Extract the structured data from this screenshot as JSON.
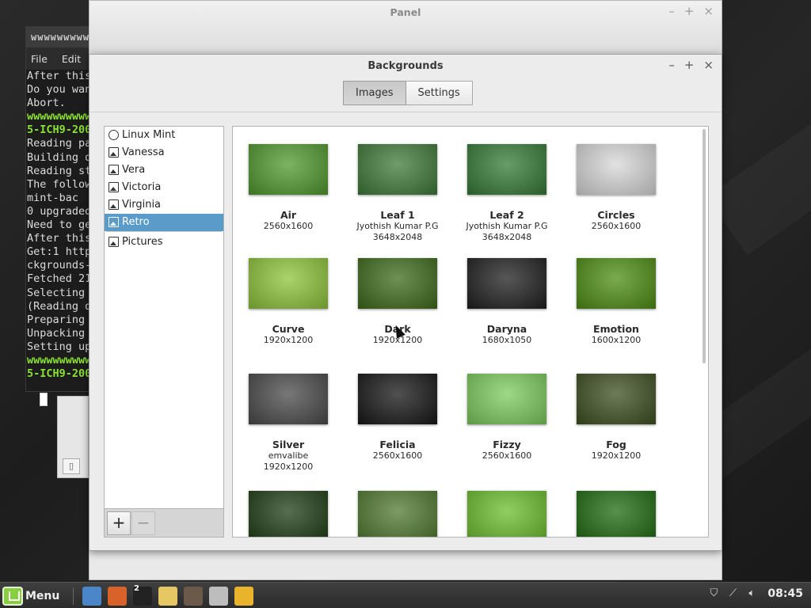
{
  "terminal": {
    "title": "wwwwwwwwwwww",
    "menu": [
      "File",
      "Edit"
    ],
    "lines": [
      {
        "t": "After this",
        "green": false
      },
      {
        "t": "Do you wan",
        "green": false
      },
      {
        "t": "Abort.",
        "green": false
      },
      {
        "t": "wwwwwwwwwwww",
        "green": true
      },
      {
        "t": "5-ICH9-200",
        "green": true
      },
      {
        "t": "Reading pa",
        "green": false
      },
      {
        "t": "Building d",
        "green": false
      },
      {
        "t": "Reading st",
        "green": false
      },
      {
        "t": "The follow",
        "green": false
      },
      {
        "t": "  mint-bac",
        "green": false
      },
      {
        "t": "0 upgraded",
        "green": false
      },
      {
        "t": "Need to ge",
        "green": false
      },
      {
        "t": "After this",
        "green": false
      },
      {
        "t": "Get:1 http",
        "green": false
      },
      {
        "t": "ckgrounds-",
        "green": false
      },
      {
        "t": "Fetched 21",
        "green": false
      },
      {
        "t": "Selecting",
        "green": false
      },
      {
        "t": "(Reading d",
        "green": false
      },
      {
        "t": "Preparing",
        "green": false
      },
      {
        "t": "Unpacking",
        "green": false
      },
      {
        "t": "Setting up",
        "green": false
      },
      {
        "t": "wwwwwwwwwwww",
        "green": true
      },
      {
        "t": "5-ICH9-200",
        "green": true
      }
    ]
  },
  "panel_window": {
    "title": "Panel",
    "controls": [
      "–",
      "+",
      "×"
    ]
  },
  "backgrounds_window": {
    "title": "Backgrounds",
    "controls": [
      "–",
      "+",
      "×"
    ],
    "tabs": [
      {
        "label": "Images",
        "active": true
      },
      {
        "label": "Settings",
        "active": false
      }
    ]
  },
  "sidebar": {
    "items": [
      {
        "label": "Linux Mint",
        "icon": "mint-icon",
        "selected": false
      },
      {
        "label": "Vanessa",
        "icon": "image-icon",
        "selected": false
      },
      {
        "label": "Vera",
        "icon": "image-icon",
        "selected": false
      },
      {
        "label": "Victoria",
        "icon": "image-icon",
        "selected": false
      },
      {
        "label": "Virginia",
        "icon": "image-icon",
        "selected": false
      },
      {
        "label": "Retro",
        "icon": "image-icon",
        "selected": true
      }
    ],
    "extra_items": [
      {
        "label": "Pictures",
        "icon": "folder-icon"
      }
    ],
    "add_label": "+",
    "remove_label": "−"
  },
  "wallpapers": [
    {
      "name": "Air",
      "author": "",
      "res": "2560x1600",
      "bg": "#4f9a2f"
    },
    {
      "name": "Leaf 1",
      "author": "Jyothish Kumar P.G",
      "res": "3648x2048",
      "bg": "#3f7a3a"
    },
    {
      "name": "Leaf 2",
      "author": "Jyothish Kumar P.G",
      "res": "3648x2048",
      "bg": "#357a36"
    },
    {
      "name": "Circles",
      "author": "",
      "res": "2560x1600",
      "bg": "#d8d8d8"
    },
    {
      "name": "Curve",
      "author": "",
      "res": "1920x1200",
      "bg": "#8ec63a"
    },
    {
      "name": "Dark",
      "author": "",
      "res": "1920x1200",
      "bg": "#3e6b1a"
    },
    {
      "name": "Daryna",
      "author": "",
      "res": "1680x1050",
      "bg": "#1f1f1f"
    },
    {
      "name": "Emotion",
      "author": "",
      "res": "1600x1200",
      "bg": "#4e8d14"
    },
    {
      "name": "Silver",
      "author": "emvalibe",
      "res": "1920x1200",
      "bg": "#4a4a4a"
    },
    {
      "name": "Felicia",
      "author": "",
      "res": "2560x1600",
      "bg": "#161616"
    },
    {
      "name": "Fizzy",
      "author": "",
      "res": "2560x1600",
      "bg": "#7ccc5e"
    },
    {
      "name": "Fog",
      "author": "",
      "res": "1920x1200",
      "bg": "#3d4f20"
    },
    {
      "name": "",
      "author": "",
      "res": "",
      "bg": "#1f3d14"
    },
    {
      "name": "",
      "author": "",
      "res": "",
      "bg": "#4f7a30"
    },
    {
      "name": "",
      "author": "",
      "res": "",
      "bg": "#6cbf2f"
    },
    {
      "name": "",
      "author": "",
      "res": "",
      "bg": "#1f6a10"
    }
  ],
  "taskbar": {
    "menu_label": "Menu",
    "launchers": [
      {
        "name": "files-icon",
        "color": "#4a86c8"
      },
      {
        "name": "firefox-icon",
        "color": "#d8622a"
      },
      {
        "name": "terminal-icon",
        "color": "#222222"
      },
      {
        "name": "text-editor-icon",
        "color": "#e5c763"
      },
      {
        "name": "package-icon",
        "color": "#6b5a4a"
      },
      {
        "name": "window-icon",
        "color": "#bdbdbd"
      },
      {
        "name": "backgrounds-icon",
        "color": "#e9b32c"
      }
    ],
    "terminal_badge": "2",
    "clock": "08:45"
  }
}
